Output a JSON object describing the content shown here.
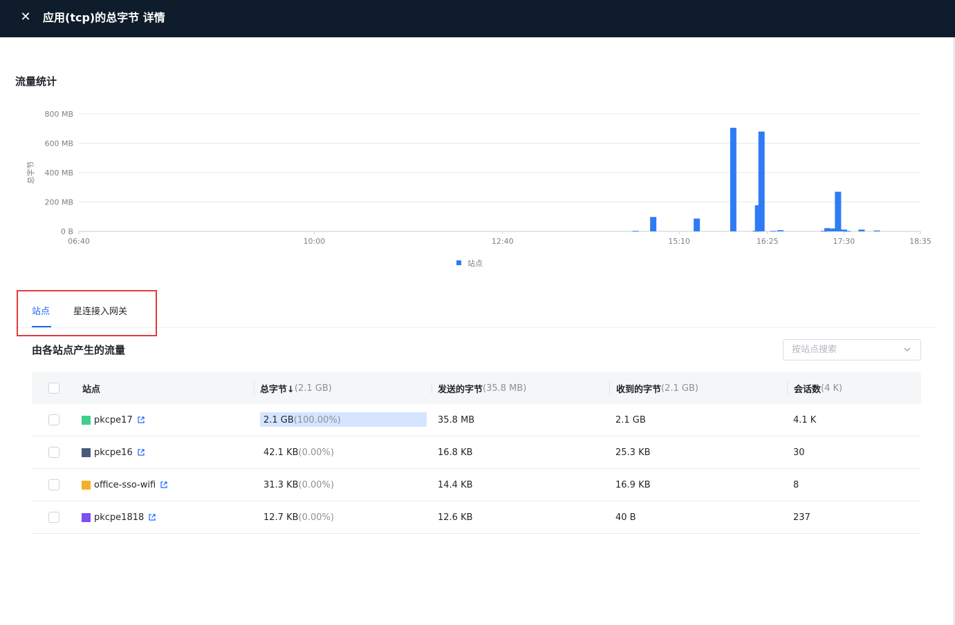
{
  "header": {
    "title": "应用(tcp)的总字节 详情",
    "close_icon": "close-icon",
    "background": "#0f1c2b"
  },
  "section_title": "流量统计",
  "chart_data": {
    "type": "bar",
    "title": "",
    "xlabel": "",
    "ylabel": "总字节",
    "unit": "MB",
    "ylim": [
      0,
      800
    ],
    "y_ticks": [
      "800 MB",
      "600 MB",
      "400 MB",
      "200 MB",
      "0 B"
    ],
    "x_ticks": [
      "06:40",
      "10:00",
      "12:40",
      "15:10",
      "16:25",
      "17:30",
      "18:35"
    ],
    "grid": true,
    "legend_position": "bottom-center",
    "series": [
      {
        "name": "站点",
        "color": "#2f7bf5",
        "x": [
          "14:33",
          "14:48",
          "15:25",
          "15:56",
          "16:15",
          "16:17",
          "16:20",
          "16:30",
          "16:36",
          "17:13",
          "17:16",
          "17:19",
          "17:22",
          "17:25",
          "17:30",
          "17:33",
          "17:45",
          "17:58"
        ],
        "values": [
          3,
          98,
          87,
          706,
          3,
          178,
          680,
          3,
          8,
          3,
          22,
          18,
          20,
          270,
          12,
          3,
          12,
          6
        ]
      }
    ]
  },
  "tabs": {
    "items": [
      {
        "label": "站点",
        "active": true
      },
      {
        "label": "星连接入网关",
        "active": false
      }
    ]
  },
  "table_title": "由各站点产生的流量",
  "search": {
    "placeholder": "按站点搜索",
    "chevron_icon": "chevron-down-icon"
  },
  "table": {
    "headers": {
      "site": "站点",
      "total": "总字节↓",
      "total_sum": "(2.1 GB)",
      "sent": "发送的字节",
      "sent_sum": "(35.8 MB)",
      "received": "收到的字节",
      "received_sum": "(2.1 GB)",
      "sessions": "会话数",
      "sessions_sum": "(4 K)"
    },
    "rows": [
      {
        "name": "pkcpe17",
        "color": "#3ecf8e",
        "total": "2.1 GB",
        "pct": "(100.00%)",
        "share": 1.0,
        "sent": "35.8 MB",
        "received": "2.1 GB",
        "sessions": "4.1 K"
      },
      {
        "name": "pkcpe16",
        "color": "#4a5a78",
        "total": "42.1 KB",
        "pct": "(0.00%)",
        "share": 0,
        "sent": "16.8 KB",
        "received": "25.3 KB",
        "sessions": "30"
      },
      {
        "name": "office-sso-wifi",
        "color": "#f5b125",
        "total": "31.3 KB",
        "pct": "(0.00%)",
        "share": 0,
        "sent": "14.4 KB",
        "received": "16.9 KB",
        "sessions": "8"
      },
      {
        "name": "pkcpe1818",
        "color": "#7a4ff5",
        "total": "12.7 KB",
        "pct": "(0.00%)",
        "share": 0,
        "sent": "12.6 KB",
        "received": "40 B",
        "sessions": "237"
      }
    ]
  }
}
